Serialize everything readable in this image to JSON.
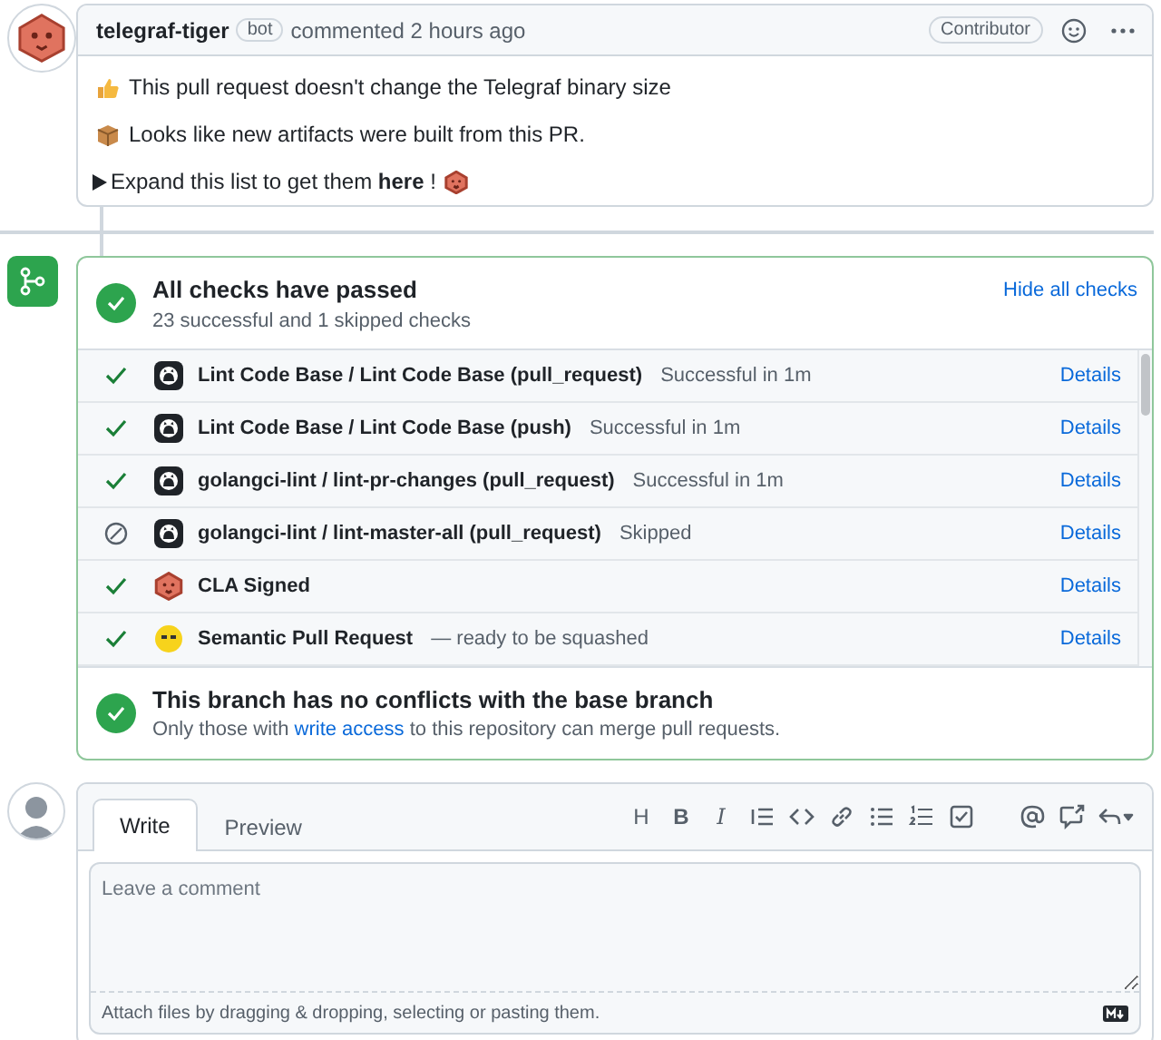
{
  "comment": {
    "author": "telegraf-tiger",
    "badge": "bot",
    "action": "commented 2 hours ago",
    "role": "Contributor",
    "lines": [
      {
        "kind": "thumbs_up",
        "text": "This pull request doesn't change the Telegraf binary size"
      },
      {
        "kind": "package",
        "text": "Looks like new artifacts were built from this PR."
      },
      {
        "kind": "details",
        "text": "Expand this list to get them **here** !"
      }
    ]
  },
  "checks": {
    "title": "All checks have passed",
    "summary": "23 successful and 1 skipped checks",
    "toggle": "Hide all checks",
    "items": [
      {
        "skipped": false,
        "kind": "github",
        "name": "Lint Code Base / Lint Code Base (pull_request)",
        "result": "Successful in 1m",
        "link": "Details"
      },
      {
        "skipped": false,
        "kind": "github",
        "name": "Lint Code Base / Lint Code Base (push)",
        "result": "Successful in 1m",
        "link": "Details"
      },
      {
        "skipped": false,
        "kind": "github",
        "name": "golangci-lint / lint-pr-changes (pull_request)",
        "result": "Successful in 1m",
        "link": "Details"
      },
      {
        "skipped": true,
        "kind": "github",
        "name": "golangci-lint / lint-master-all (pull_request)",
        "result": "Skipped",
        "link": "Details"
      },
      {
        "skipped": false,
        "kind": "tiger",
        "name": "CLA Signed",
        "link": "Details"
      },
      {
        "skipped": false,
        "kind": "semantic",
        "name": "Semantic Pull Request",
        "result": "— ready to be squashed",
        "link": "Details"
      }
    ],
    "merge": {
      "title": "This branch has no conflicts with the base branch",
      "note_before": "Only those with",
      "note_link": "write access",
      "note_after": "to this repository can merge pull requests."
    }
  },
  "composer": {
    "tabs": [
      {
        "label": "Write",
        "selected": true
      },
      {
        "label": "Preview",
        "selected": false
      }
    ],
    "toolbar": [
      {
        "kind": "heading",
        "label": "H"
      },
      {
        "kind": "bold",
        "label": "B"
      },
      {
        "kind": "italic",
        "label": "I"
      },
      {
        "kind": "quote"
      },
      {
        "kind": "code"
      },
      {
        "kind": "link"
      },
      {
        "kind": "bullet_list"
      },
      {
        "kind": "numbered_list"
      },
      {
        "kind": "task_list"
      },
      {
        "kind": "mention"
      },
      {
        "kind": "reference"
      },
      {
        "kind": "reply"
      }
    ],
    "placeholder": "Leave a comment",
    "footer": "Attach files by dragging & dropping, selecting or pasting them."
  }
}
